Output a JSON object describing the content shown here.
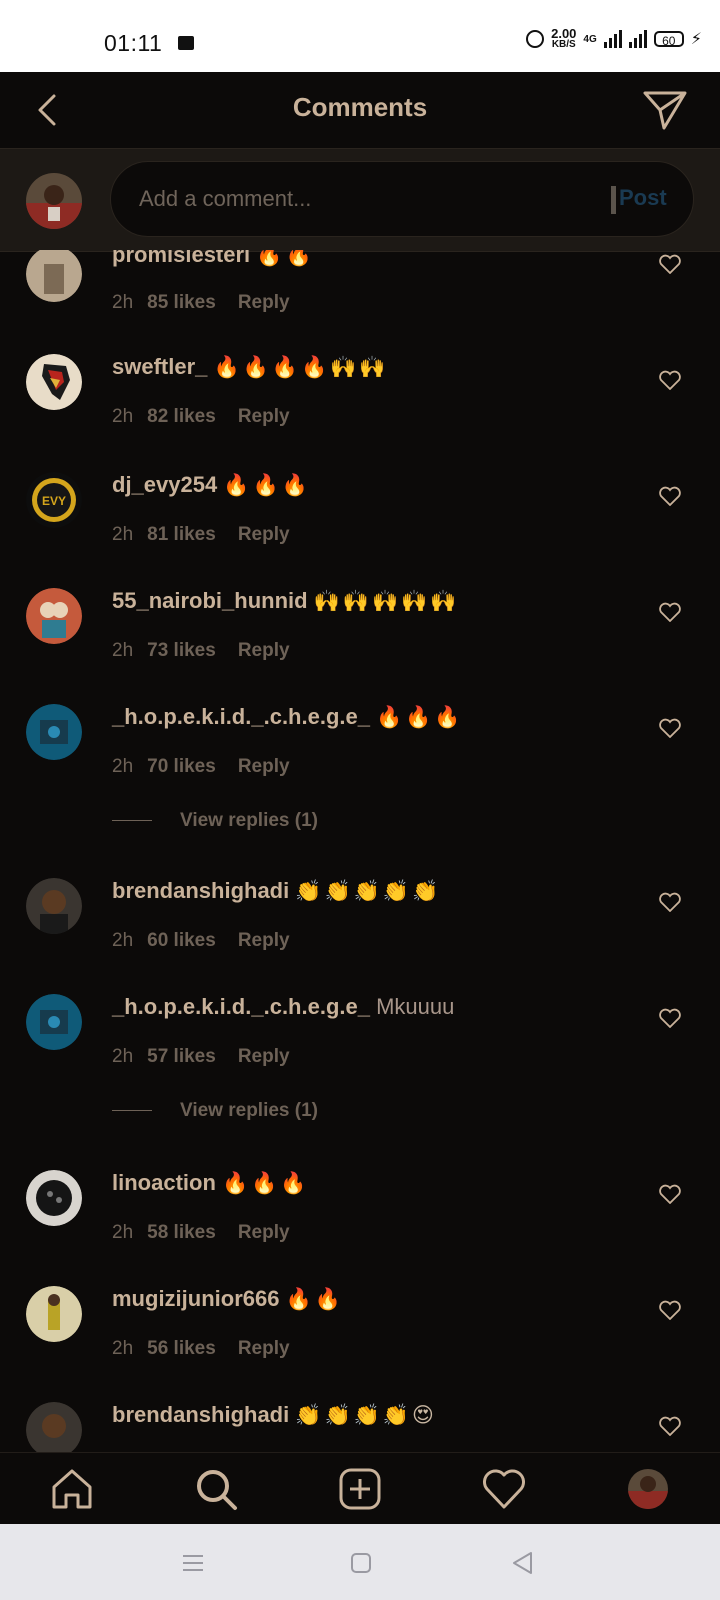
{
  "status_bar": {
    "time": "01:11",
    "speed_value": "2.00",
    "speed_unit": "KB/S",
    "network": "4G",
    "battery": "60"
  },
  "header": {
    "title": "Comments"
  },
  "composer": {
    "placeholder": "Add a comment...",
    "post_label": "Post"
  },
  "comments": [
    {
      "user": "promisiesteri",
      "text": "🔥🔥",
      "time": "2h",
      "likes": "85 likes",
      "reply": "Reply"
    },
    {
      "user": "sweftler_",
      "text": "🔥🔥🔥🔥🙌🙌",
      "time": "2h",
      "likes": "82 likes",
      "reply": "Reply"
    },
    {
      "user": "dj_evy254",
      "text": "🔥🔥🔥",
      "time": "2h",
      "likes": "81 likes",
      "reply": "Reply"
    },
    {
      "user": "55_nairobi_hunnid",
      "text": "🙌🙌🙌🙌🙌",
      "time": "2h",
      "likes": "73 likes",
      "reply": "Reply"
    },
    {
      "user": "_h.o.p.e.k.i.d._.c.h.e.g.e_",
      "text": "🔥🔥🔥",
      "time": "2h",
      "likes": "70 likes",
      "reply": "Reply",
      "view_replies": "View replies (1)"
    },
    {
      "user": "brendanshighadi",
      "text": "👏👏👏👏👏",
      "time": "2h",
      "likes": "60 likes",
      "reply": "Reply"
    },
    {
      "user": "_h.o.p.e.k.i.d._.c.h.e.g.e_",
      "text": "Mkuuuu",
      "time": "2h",
      "likes": "57 likes",
      "reply": "Reply",
      "view_replies": "View replies (1)"
    },
    {
      "user": "linoaction",
      "text": "🔥🔥🔥",
      "time": "2h",
      "likes": "58 likes",
      "reply": "Reply"
    },
    {
      "user": "mugizijunior666",
      "text": "🔥🔥",
      "time": "2h",
      "likes": "56 likes",
      "reply": "Reply"
    },
    {
      "user": "brendanshighadi",
      "text": "👏👏👏👏😍"
    }
  ],
  "bottom_nav": [
    "home-icon",
    "search-icon",
    "add-post-icon",
    "activity-heart-icon",
    "profile-avatar"
  ],
  "colors": {
    "background": "#0c0a09",
    "username": "#c9b29a",
    "meta": "#6e6257",
    "post_button": "#1a3a52"
  }
}
